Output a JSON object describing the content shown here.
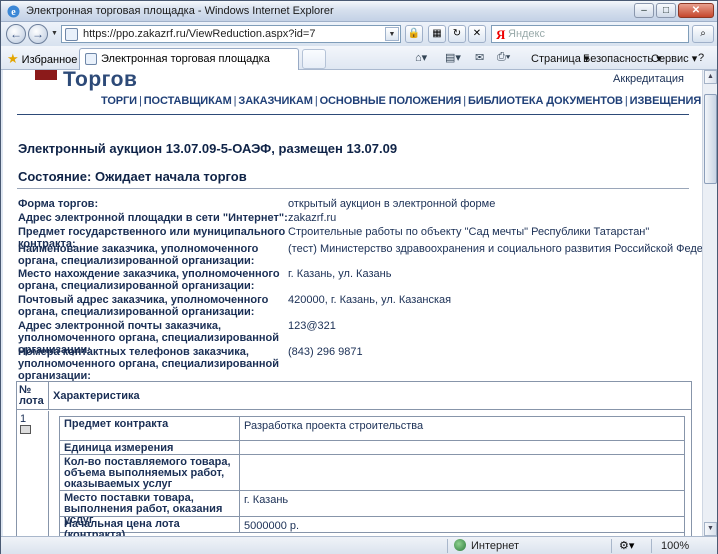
{
  "window": {
    "title": "Электронная торговая площадка - Windows Internet Explorer",
    "min": "–",
    "max": "□",
    "close": "✕"
  },
  "address": {
    "url": "https://ppo.zakazrf.ru/ViewReduction.aspx?id=7"
  },
  "search": {
    "placeholder": "Яндекс",
    "engine_glyph": "Я"
  },
  "favorites": {
    "label": "Избранное"
  },
  "tab": {
    "label": "Электронная торговая площадка"
  },
  "commands": {
    "page": "Страница",
    "security": "Безопасность",
    "tools": "Сервис",
    "help": "?"
  },
  "site": {
    "logo": "Торгов",
    "accreditation": "Аккредитация",
    "nav": [
      "ТОРГИ",
      "ПОСТАВЩИКАМ",
      "ЗАКАЗЧИКАМ",
      "ОСНОВНЫЕ ПОЛОЖЕНИЯ",
      "БИБЛИОТЕКА ДОКУМЕНТОВ",
      "ИЗВЕЩЕНИЯ О ЗАКАЗАХ"
    ],
    "nav_sep": "|"
  },
  "auction": {
    "title": "Электронный аукцион 13.07.09-5-ОАЭФ, размещен 13.07.09",
    "state": "Состояние: Ожидает начала торгов",
    "fields": [
      {
        "label": "Форма торгов:",
        "value": "открытый аукцион в электронной форме"
      },
      {
        "label": "Адрес электронной площадки в сети \"Интернет\":",
        "value": "zakazrf.ru"
      },
      {
        "label": "Предмет государственного или муниципального контракта:",
        "value": "Строительные работы по объекту \"Сад мечты\" Республики Татарстан\""
      },
      {
        "label": "Наименование заказчика, уполномоченного органа, специализированной организации:",
        "value": "(тест) Министерство здравоохранения и социального развития Российской Федерации"
      },
      {
        "label": "Место нахождение заказчика, уполномоченного органа, специализированной организации:",
        "value": "г. Казань, ул. Казань"
      },
      {
        "label": "Почтовый адрес заказчика, уполномоченного органа, специализированной организации:",
        "value": "420000, г. Казань, ул. Казанская"
      },
      {
        "label": "Адрес электронной почты заказчика, уполномоченного органа, специализированной организации:",
        "value": "123@321"
      },
      {
        "label": "Номера контактных телефонов заказчика, уполномоченного органа, специализированной организации:",
        "value": "(843) 296 9871"
      }
    ]
  },
  "lots": {
    "col_num": "№ лота",
    "col_char": "Характеристика",
    "lot_number": "1",
    "rows": [
      {
        "key": "Предмет контракта",
        "value": "Разработка проекта строительства"
      },
      {
        "key": "Единица измерения",
        "value": ""
      },
      {
        "key": "Кол-во поставляемого товара, объема выполняемых работ, оказываемых услуг",
        "value": ""
      },
      {
        "key": "Место поставки товара, выполнения работ, оказания услуг",
        "value": "г. Казань"
      },
      {
        "key": "Начальная цена лота (контракта)",
        "value": "5000000 р."
      }
    ]
  },
  "status": {
    "zone": "Интернет",
    "zoom": "100%"
  }
}
